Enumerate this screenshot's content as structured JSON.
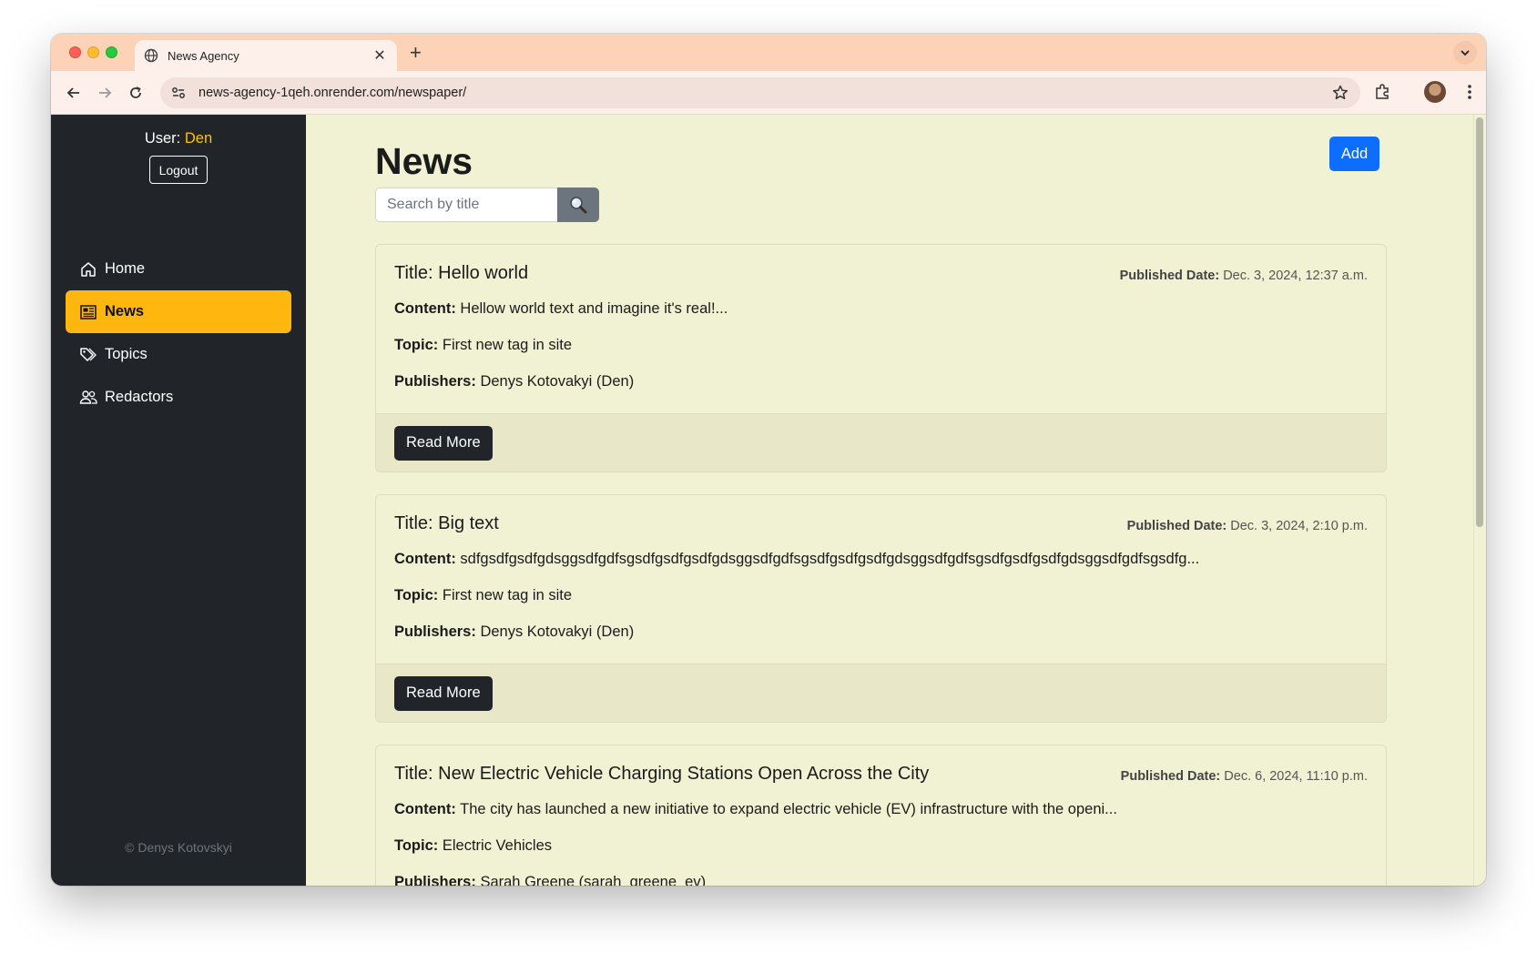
{
  "browser": {
    "tab_title": "News Agency",
    "url": "news-agency-1qeh.onrender.com/newspaper/"
  },
  "sidebar": {
    "user_label": "User:",
    "user_name": "Den",
    "logout_label": "Logout",
    "items": [
      {
        "label": "Home",
        "icon": "home-icon"
      },
      {
        "label": "News",
        "icon": "newspaper-icon",
        "active": true
      },
      {
        "label": "Topics",
        "icon": "tags-icon"
      },
      {
        "label": "Redactors",
        "icon": "people-icon"
      }
    ],
    "footer": "© Denys Kotovskyi"
  },
  "main": {
    "title": "News",
    "add_label": "Add",
    "search_placeholder": "Search by title",
    "labels": {
      "published": "Published Date:",
      "content": "Content:",
      "topic": "Topic:",
      "publishers": "Publishers:",
      "read_more": "Read More"
    },
    "articles": [
      {
        "title": "Title: Hello world",
        "date": "Dec. 3, 2024, 12:37 a.m.",
        "content": "Hellow world text and imagine it's real!...",
        "topic": "First new tag in site",
        "publishers": "Denys Kotovakyi (Den)"
      },
      {
        "title": "Title: Big text",
        "date": "Dec. 3, 2024, 2:10 p.m.",
        "content": "sdfgsdfgsdfgdsggsdfgdfsgsdfgsdfgsdfgdsggsdfgdfsgsdfgsdfgsdfgdsggsdfgdfsgsdfgsdfgsdfgdsggsdfgdfsgsdfg...",
        "topic": "First new tag in site",
        "publishers": "Denys Kotovakyi (Den)"
      },
      {
        "title": "Title: New Electric Vehicle Charging Stations Open Across the City",
        "date": "Dec. 6, 2024, 11:10 p.m.",
        "content": "The city has launched a new initiative to expand electric vehicle (EV) infrastructure with the openi...",
        "topic": "Electric Vehicles",
        "publishers": "Sarah Greene (sarah_greene_ev)"
      }
    ]
  },
  "colors": {
    "accent": "#ffb70f",
    "primary": "#0d6efd",
    "sidebar_bg": "#212529",
    "page_bg": "#f1f1d4"
  }
}
